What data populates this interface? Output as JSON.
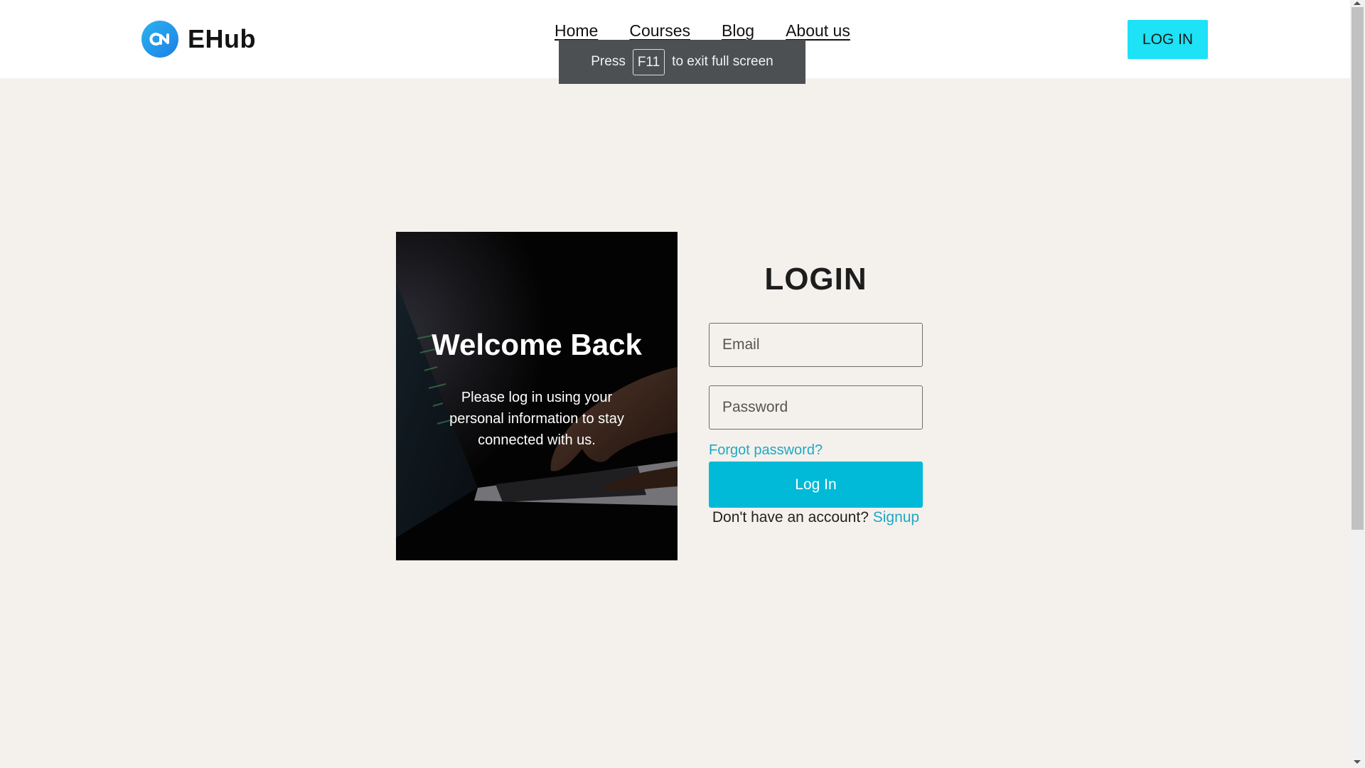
{
  "header": {
    "brand": "EHub",
    "nav": [
      {
        "label": "Home"
      },
      {
        "label": "Courses"
      },
      {
        "label": "Blog"
      },
      {
        "label": "About us"
      }
    ],
    "login_button": "LOG IN",
    "colors": {
      "accent": "#1ee2f5",
      "logo": "#1e8fe8"
    }
  },
  "fullscreen_toast": {
    "prefix": "Press",
    "key": "F11",
    "suffix": "to exit full screen"
  },
  "welcome_panel": {
    "title": "Welcome Back",
    "message": "Please log in using your personal information to stay connected with us.",
    "image": "laptop-typing-photo"
  },
  "login_form": {
    "title": "LOGIN",
    "email_placeholder": "Email",
    "password_placeholder": "Password",
    "forgot_link": "Forgot password?",
    "submit_label": "Log In",
    "signup_prompt": "Don't have an account?",
    "signup_link": "Signup",
    "colors": {
      "button": "#00bad8",
      "link": "#1fa8c4"
    }
  }
}
